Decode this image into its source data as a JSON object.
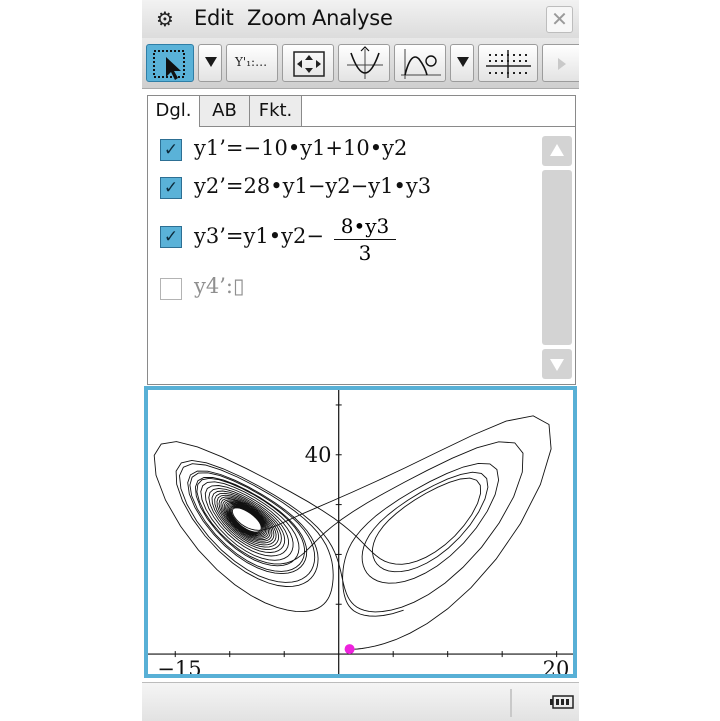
{
  "menu": {
    "edit": "Edit",
    "zoom": "Zoom",
    "analyse": "Analyse",
    "close": "✕"
  },
  "toolbar": {
    "yvar_label": "Y'₁:…",
    "icons": [
      "select-arrow-icon",
      "dropdown-icon",
      "y-variable-icon",
      "zoom-box-icon",
      "trace-icon",
      "analysis-icon",
      "dropdown-icon",
      "grid-icon",
      "next-arrow-icon"
    ]
  },
  "editor": {
    "tabs": [
      {
        "label": "Dgl.",
        "active": true
      },
      {
        "label": "AB",
        "active": false
      },
      {
        "label": "Fkt.",
        "active": false
      }
    ],
    "equations": [
      {
        "checked": true,
        "text": "y1’=−10•y1+10•y2"
      },
      {
        "checked": true,
        "text": "y2’=28•y1−y2−y1•y3"
      },
      {
        "checked": true,
        "text": "y3’=y1•y2−",
        "frac_num": "8•y3",
        "frac_den": "3"
      },
      {
        "checked": false,
        "text": "y4’:▯"
      }
    ]
  },
  "graph": {
    "x_min_label": "−15",
    "x_max_label": "20",
    "y_label": "40",
    "xlim": [
      -17.5,
      21.5
    ],
    "ylim": [
      -4,
      53
    ],
    "marker_color": "#ee22dd",
    "border_color": "#58b0d6"
  },
  "status": {
    "battery": "battery-full-icon"
  }
}
